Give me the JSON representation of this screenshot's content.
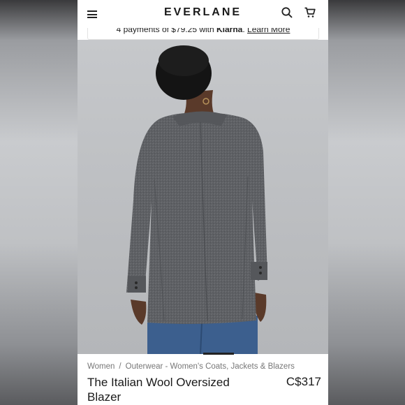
{
  "header": {
    "brand": "EVERLANE",
    "menu_icon": "hamburger-menu-icon",
    "search_icon": "search-icon",
    "cart_icon": "cart-icon"
  },
  "promo": {
    "text_before": "4 payments of $79.25 with ",
    "provider": "Klarna",
    "text_after": ". ",
    "link": "Learn More"
  },
  "breadcrumb": {
    "level1": "Women",
    "separator": "/",
    "level2": "Outerwear - Women's Coats, Jackets & Blazers"
  },
  "product": {
    "title": "The Italian Wool Oversized Blazer",
    "price": "C$317"
  },
  "colors": {
    "text": "#1a1a1a",
    "muted": "#777777",
    "blazer": "#5c5e62",
    "denim": "#3b5f8c",
    "skin": "#5a3a2a"
  }
}
